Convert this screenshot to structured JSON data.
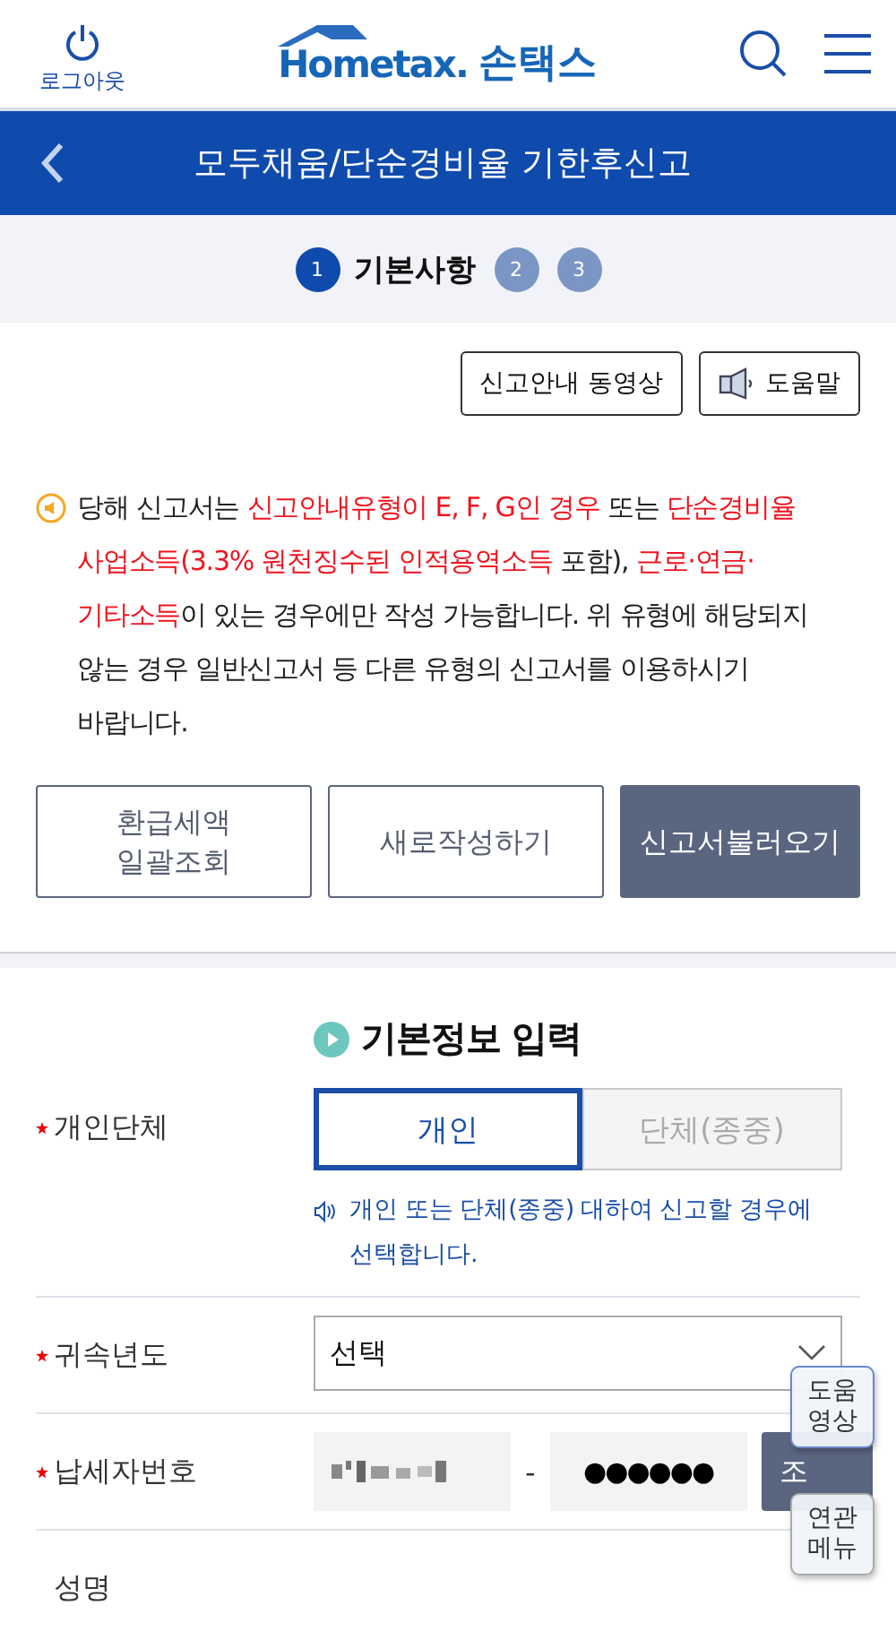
{
  "header": {
    "logout": "로그아웃",
    "logo": "Hometax.",
    "app_name": "손택스"
  },
  "title_bar": {
    "title": "모두채움/단순경비율 기한후신고"
  },
  "steps": [
    {
      "number": "1",
      "label": "기본사항",
      "selected": true
    },
    {
      "number": "2",
      "selected": false
    },
    {
      "number": "3",
      "selected": false
    }
  ],
  "top_buttons": [
    {
      "label": "신고안내 동영상",
      "kind": "plain"
    },
    {
      "label": "도움말",
      "kind": "speaker"
    }
  ],
  "notice": {
    "segments": [
      {
        "text": "당해 신고서는 ",
        "highlight": false
      },
      {
        "text": "신고안내유형이 E, F, G인 경우",
        "highlight": true
      },
      {
        "text": " 또는 ",
        "highlight": false
      },
      {
        "text": "단순경비율 사업소득(3.3% 원천징수된 인적용역소득",
        "highlight": true
      },
      {
        "text": " 포함), ",
        "highlight": false
      },
      {
        "text": "근로·연금·기타소득",
        "highlight": true
      },
      {
        "text": "이 있는 경우에만 작성 가능합니다. 위 유형에 해당되지 않는 경우 일반신고서 등 다른 유형의 신고서를 이용하시기 바랍니다.",
        "highlight": false
      }
    ]
  },
  "actions": [
    {
      "label": "환급세액 일괄조회",
      "primary": false
    },
    {
      "label": "새로작성하기",
      "primary": false
    },
    {
      "label": "신고서불러오기",
      "primary": true
    }
  ],
  "section": {
    "title": "기본정보 입력"
  },
  "fields": [
    {
      "label": "개인단체",
      "required": true,
      "kind": "toggle",
      "options": [
        {
          "label": "개인",
          "selected": true
        },
        {
          "label": "단체(종중)",
          "selected": false
        }
      ],
      "hint": "개인 또는 단체(종중) 대하여 신고할 경우에 선택합니다."
    },
    {
      "label": "귀속년도",
      "required": true,
      "kind": "select",
      "value": "선택"
    },
    {
      "label": "납세자번호",
      "required": true,
      "kind": "taxid",
      "separator": "-",
      "masked_value": "●●●●●●",
      "button": "조"
    },
    {
      "label": "성명",
      "required": false,
      "kind": "text"
    }
  ],
  "floating_buttons": [
    "도움 영상",
    "연관 메뉴"
  ]
}
